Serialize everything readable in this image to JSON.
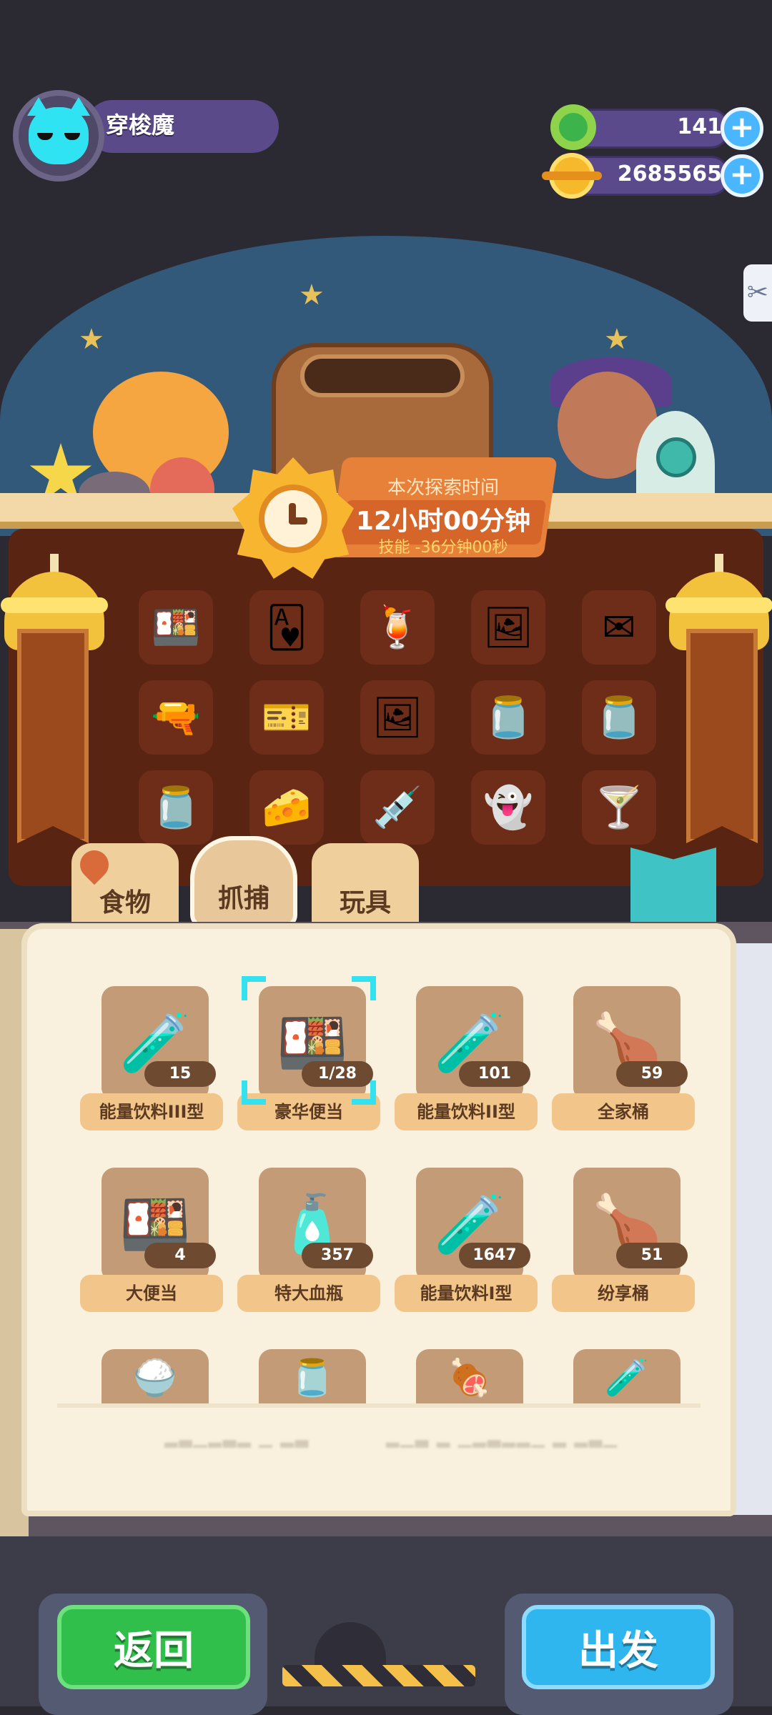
{
  "player": {
    "name": "穿梭魔"
  },
  "currencies": [
    {
      "icon": "green-donut-coin-icon",
      "value": "141"
    },
    {
      "icon": "gold-planet-coin-icon",
      "value": "2685565"
    }
  ],
  "explore": {
    "time_label": "本次探索时间",
    "time_value": "12小时00分钟",
    "skill_text": "技能 -36分钟00秒"
  },
  "explore_slots": [
    {
      "icon": "bento-icon",
      "glyph": "🍱"
    },
    {
      "icon": "heart-card-icon",
      "glyph": "🂱"
    },
    {
      "icon": "drink-cup-icon",
      "glyph": "🍹"
    },
    {
      "icon": "portrait-card-icon",
      "glyph": "🖼"
    },
    {
      "icon": "letter-icon",
      "glyph": "✉"
    },
    {
      "icon": "toy-gun-icon",
      "glyph": "🔫"
    },
    {
      "icon": "ticket-icon",
      "glyph": "🎫"
    },
    {
      "icon": "photo-icon",
      "glyph": "🖼"
    },
    {
      "icon": "empty-bottle-icon",
      "glyph": "🫙"
    },
    {
      "icon": "empty-bottle-icon",
      "glyph": "🫙"
    },
    {
      "icon": "empty-bottle-icon",
      "glyph": "🫙"
    },
    {
      "icon": "cheese-cube-icon",
      "glyph": "🧀"
    },
    {
      "icon": "dropper-icon",
      "glyph": "💉"
    },
    {
      "icon": "ghost-spirit-icon",
      "glyph": "👻"
    },
    {
      "icon": "juice-glass-icon",
      "glyph": "🍸"
    }
  ],
  "tabs": [
    {
      "label": "食物",
      "active": false
    },
    {
      "label": "抓捕",
      "active": true
    },
    {
      "label": "玩具",
      "active": false
    }
  ],
  "items": [
    {
      "name": "能量饮料III型",
      "count": "15",
      "glyph": "🧪",
      "selected": false
    },
    {
      "name": "豪华便当",
      "count": "1/28",
      "glyph": "🍱",
      "selected": true
    },
    {
      "name": "能量饮料II型",
      "count": "101",
      "glyph": "🧪",
      "selected": false
    },
    {
      "name": "全家桶",
      "count": "59",
      "glyph": "🍗",
      "selected": false
    },
    {
      "name": "大便当",
      "count": "4",
      "glyph": "🍱",
      "selected": false
    },
    {
      "name": "特大血瓶",
      "count": "357",
      "glyph": "🧴",
      "selected": false
    },
    {
      "name": "能量饮料I型",
      "count": "1647",
      "glyph": "🧪",
      "selected": false
    },
    {
      "name": "纷享桶",
      "count": "51",
      "glyph": "🍗",
      "selected": false
    }
  ],
  "partial_items": [
    {
      "glyph": "🍚"
    },
    {
      "glyph": "🫙"
    },
    {
      "glyph": "🍖"
    },
    {
      "glyph": "🧪"
    }
  ],
  "buttons": {
    "back": "返回",
    "go": "出发"
  },
  "colors": {
    "back_button": "#2fbf4a",
    "go_button": "#2fb6ee",
    "selection_highlight": "#34e1ef",
    "item_label_bg": "#f2c68a"
  }
}
